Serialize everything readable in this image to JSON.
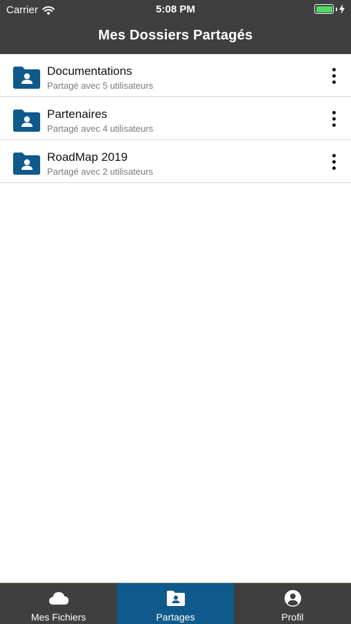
{
  "status_bar": {
    "carrier": "Carrier",
    "time": "5:08 PM"
  },
  "header": {
    "title": "Mes Dossiers Partagés"
  },
  "folders": [
    {
      "name": "Documentations",
      "subtitle": "Partagé avec 5 utilisateurs"
    },
    {
      "name": "Partenaires",
      "subtitle": "Partagé avec 4 utilisateurs"
    },
    {
      "name": "RoadMap 2019",
      "subtitle": "Partagé avec 2 utilisateurs"
    }
  ],
  "tabs": [
    {
      "label": "Mes Fichiers",
      "icon": "cloud-icon"
    },
    {
      "label": "Partages",
      "icon": "shared-folder-icon",
      "active": true
    },
    {
      "label": "Profil",
      "icon": "profile-icon"
    }
  ],
  "colors": {
    "bar_background": "#3f3f3f",
    "accent": "#0f5a8a",
    "battery": "#4cd964"
  }
}
